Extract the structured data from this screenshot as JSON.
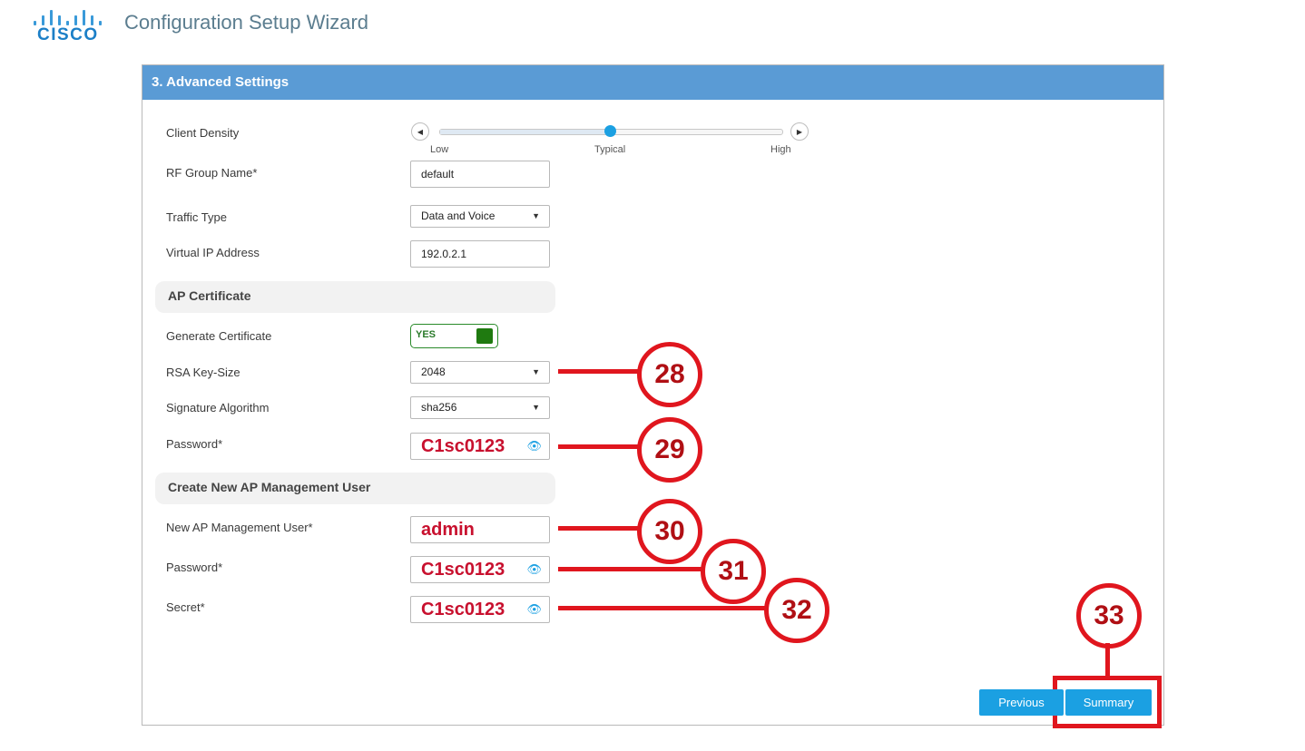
{
  "brand": {
    "logo_text": "CISCO",
    "title": "Configuration Setup Wizard"
  },
  "panel": {
    "title": "3. Advanced Settings"
  },
  "client_density": {
    "label": "Client Density",
    "ticks": [
      "Low",
      "Typical",
      "High"
    ],
    "value": "Typical",
    "position_fraction": 0.5
  },
  "rf_group": {
    "label": "RF Group Name*",
    "value": "default"
  },
  "traffic_type": {
    "label": "Traffic Type",
    "value": "Data and Voice"
  },
  "virtual_ip": {
    "label": "Virtual IP Address",
    "value": "192.0.2.1"
  },
  "ap_certificate": {
    "heading": "AP Certificate",
    "generate": {
      "label": "Generate Certificate",
      "toggle_text": "YES",
      "enabled": true
    },
    "rsa_key_size": {
      "label": "RSA Key-Size",
      "value": "2048"
    },
    "signature_algorithm": {
      "label": "Signature Algorithm",
      "value": "sha256"
    },
    "password": {
      "label": "Password*",
      "value": "C1sc0123"
    }
  },
  "ap_management_user": {
    "heading": "Create New AP Management User",
    "user": {
      "label": "New AP Management User*",
      "value": "admin"
    },
    "password": {
      "label": "Password*",
      "value": "C1sc0123"
    },
    "secret": {
      "label": "Secret*",
      "value": "C1sc0123"
    }
  },
  "callouts": [
    "28",
    "29",
    "30",
    "31",
    "32",
    "33"
  ],
  "buttons": {
    "previous": "Previous",
    "summary": "Summary"
  },
  "colors": {
    "header": "#5a9bd5",
    "accent": "#1ba0e2",
    "callout": "#e0161e",
    "toggle_on": "#1f7a10"
  },
  "icons": {
    "eye": "eye-icon",
    "caret": "chevron-down-icon",
    "left": "chevron-left-icon",
    "right": "chevron-right-icon"
  }
}
